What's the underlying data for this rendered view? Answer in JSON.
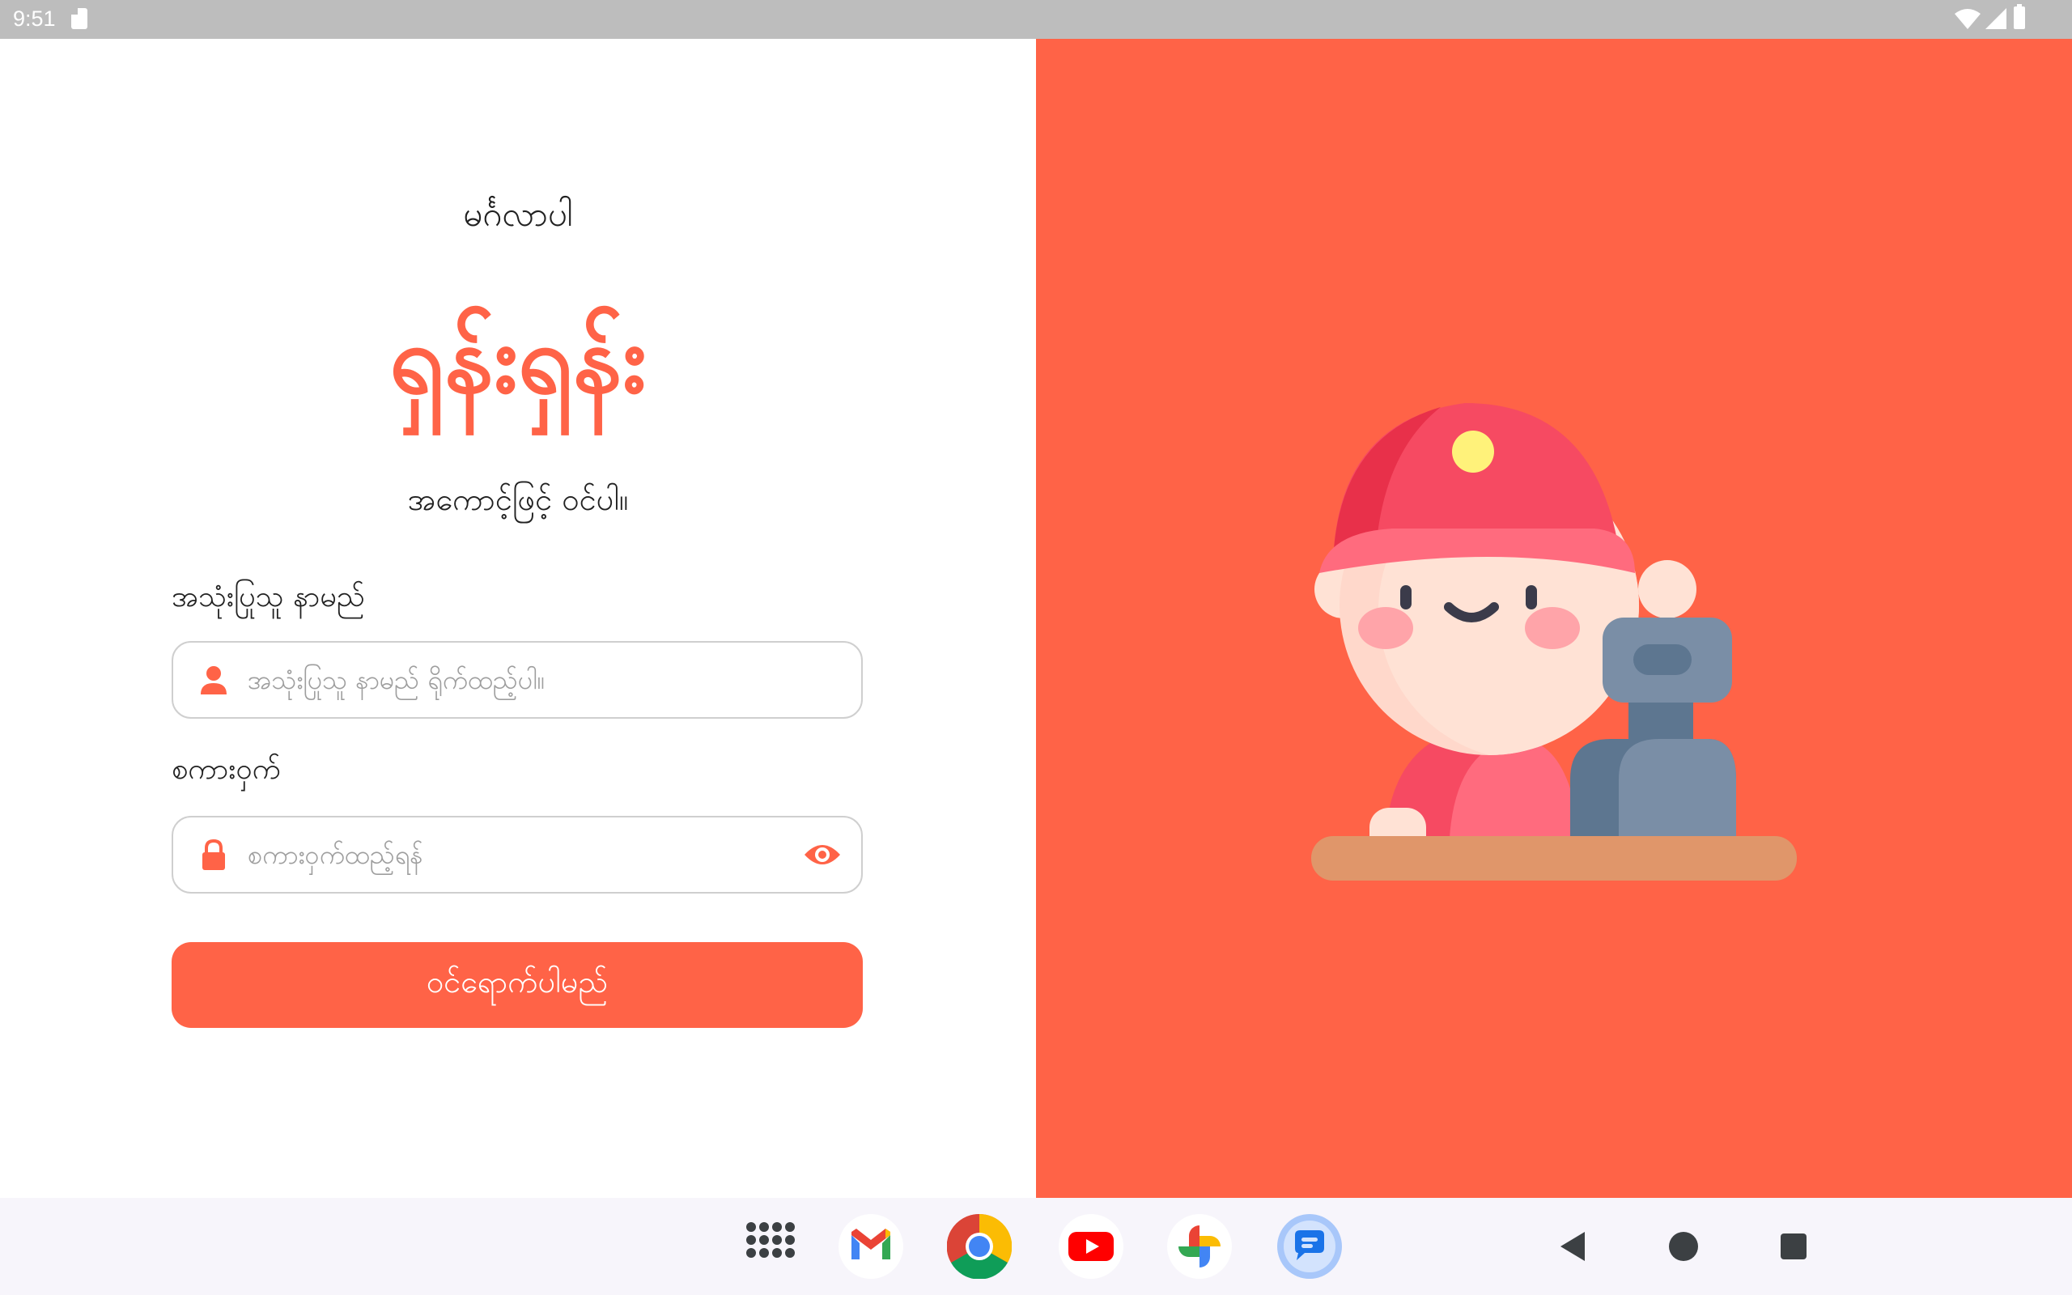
{
  "status_bar": {
    "time": "9:51",
    "icons": [
      "sd-card-icon",
      "wifi-icon",
      "signal-icon",
      "battery-icon"
    ]
  },
  "login": {
    "welcome": "မင်္ဂလာပါ",
    "app_name": "ရှန်းရှန်း",
    "subtitle": "အကောင့်ဖြင့် ဝင်ပါ။",
    "username": {
      "label": "အသုံးပြုသူ နာမည်",
      "placeholder": "အသုံးပြုသူ နာမည် ရိုက်ထည့်ပါ။",
      "value": "",
      "icon": "person-icon"
    },
    "password": {
      "label": "စကားဝှက်",
      "placeholder": "စကားဝှက်ထည့်ရန်",
      "value": "",
      "icon": "lock-icon",
      "toggle_icon": "eye-icon"
    },
    "submit_label": "ဝင်ရောက်ပါမည်"
  },
  "colors": {
    "accent": "#ff6347",
    "status_bar": "#bdbdbd",
    "nav_bar": "#f7f5fb"
  },
  "dock": {
    "apps": [
      "app-drawer-icon",
      "gmail-icon",
      "chrome-icon",
      "youtube-icon",
      "photos-icon",
      "messages-icon"
    ]
  },
  "nav": {
    "buttons": [
      "back-icon",
      "home-icon",
      "recents-icon"
    ]
  }
}
